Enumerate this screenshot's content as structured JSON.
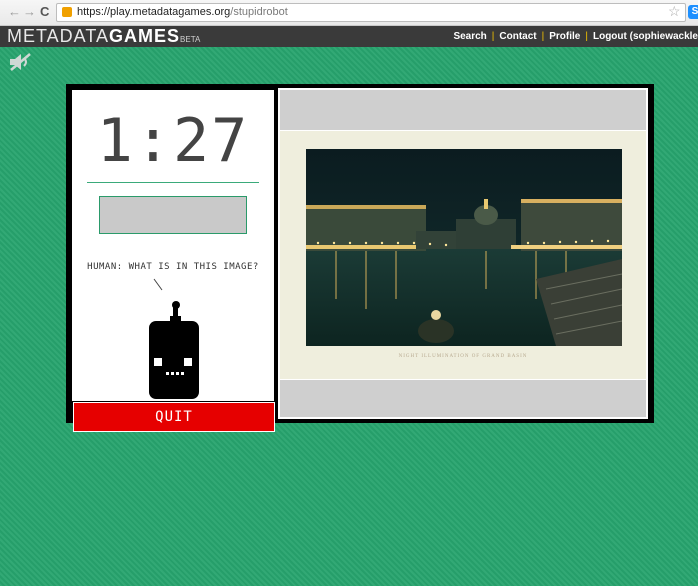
{
  "browser": {
    "url_host": "https://play.metadatagames.org",
    "url_path": "/stupidrobot",
    "back_icon": "back-arrow-icon",
    "forward_icon": "forward-arrow-icon",
    "reload_glyph": "C",
    "extension_badge": "S"
  },
  "header": {
    "logo_prefix": "METADATA",
    "logo_bold": "GAMES",
    "logo_suffix": "BETA",
    "nav": [
      "Search",
      "Contact",
      "Profile",
      "Logout (sophiewackle"
    ]
  },
  "game": {
    "timer": "1:27",
    "answer_value": "",
    "question": "HUMAN: WHAT IS IN THIS IMAGE?",
    "quit_label": "QUIT",
    "image_caption": "NIGHT ILLUMINATION OF GRAND BASIN"
  },
  "colors": {
    "page_bg": "#27a46e",
    "quit_bg": "#e60000",
    "header_bg": "#3a3a3a",
    "nav_separator": "#f3c300"
  }
}
